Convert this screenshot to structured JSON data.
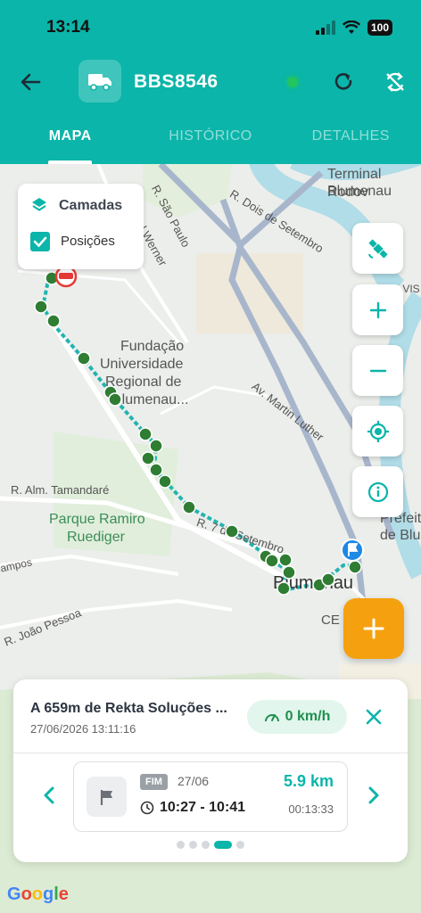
{
  "status_bar": {
    "time": "13:14",
    "battery": "100"
  },
  "header": {
    "plate": "BBS8546",
    "online_color": "#22c55e",
    "accent": "#0bb5a9"
  },
  "tabs": [
    {
      "label": "MAPA",
      "active": true
    },
    {
      "label": "HISTÓRICO",
      "active": false
    },
    {
      "label": "DETALHES",
      "active": false
    }
  ],
  "layers_panel": {
    "title": "Camadas",
    "option_label": "Posições",
    "option_checked": true
  },
  "map_labels": {
    "terminal": "Terminal Rodov",
    "blumenau_top": "Blumenau",
    "r_sao_paulo": "R. São Paulo",
    "r_dois_setembro": "R. Dois de Setembro",
    "paul_werner": "Paul Werner",
    "fundacao": "Fundação",
    "universidade": "Universidade",
    "regional": "Regional de",
    "blumenau_univ": "Blumenau...",
    "av_martin_luther": "Av. Martin Luther",
    "r_alm_tamandare": "R. Alm. Tamandaré",
    "parque_1": "Parque Ramiro",
    "parque_2": "Ruediger",
    "r_7_setembro": "R. 7 de Setembro",
    "blumenau_center": "Blumenau",
    "ce": "CE",
    "r_joao_pessoa": "R. João Pessoa",
    "campos": "ampos",
    "prefeit": "Prefeit",
    "de_blu": "de Blu",
    "rsa_vis": "RSA VIS"
  },
  "info_card": {
    "address": "A 659m de Rekta Soluções ...",
    "timestamp": "27/06/2026 13:11:16",
    "speed": "0 km/h"
  },
  "trip": {
    "badge": "FIM",
    "date": "27/06",
    "hours": "10:27 - 10:41",
    "distance": "5.9 km",
    "duration": "00:13:33"
  },
  "pager": {
    "count": 5,
    "active_index": 3
  },
  "google_logo": "Google"
}
